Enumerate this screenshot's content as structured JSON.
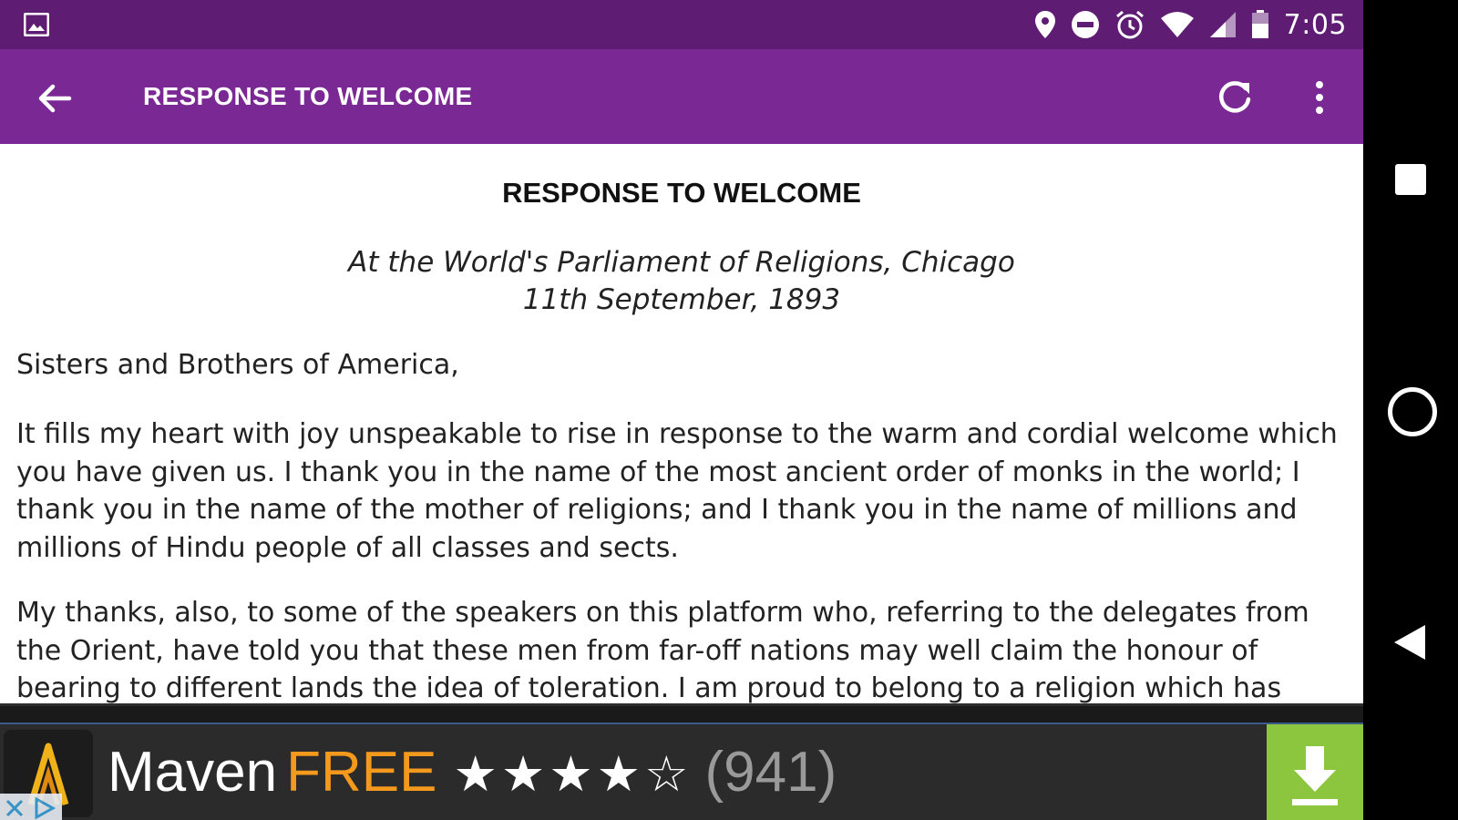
{
  "status_bar": {
    "time": "7:05",
    "icons": [
      "image-icon",
      "location-icon",
      "do-not-disturb-icon",
      "alarm-icon",
      "wifi-icon",
      "signal-icon",
      "battery-icon"
    ]
  },
  "app_bar": {
    "title": "RESPONSE TO WELCOME",
    "back_icon": "arrow-back-icon",
    "refresh_icon": "refresh-icon",
    "overflow_icon": "more-vert-icon",
    "background": "#7a2893"
  },
  "article": {
    "heading": "RESPONSE TO WELCOME",
    "subtitle_line1": "At the World's Parliament of Religions, Chicago",
    "subtitle_line2": "11th September, 1893",
    "salutation": "Sisters and Brothers of America,",
    "paragraph1": "It fills my heart with joy unspeakable to rise in response to the warm and cordial welcome which you have given us. I thank you in the name of the most ancient order of monks in the world; I thank you in the name of the mother of religions; and I thank you in the name of millions and millions of Hindu people of all classes and sects.",
    "paragraph2": "My thanks, also, to some of the speakers on this platform who, referring to the delegates from the Orient, have told you that these men from far-off nations may well claim the honour of bearing to different lands the idea of toleration. I am proud to belong to a religion which has"
  },
  "ad": {
    "app_name": "Maven",
    "price": "FREE",
    "rating_stars": "★★★★☆",
    "rating": 4,
    "rating_max": 5,
    "review_count": "(941)",
    "download_icon": "download-icon",
    "accent_color": "#f39a1e",
    "button_color": "#8cc63f"
  },
  "nav_bar": {
    "buttons": [
      "recents-button",
      "home-button",
      "back-button"
    ]
  },
  "colors": {
    "status_bar": "#5e1c73",
    "app_bar": "#7a2893"
  }
}
